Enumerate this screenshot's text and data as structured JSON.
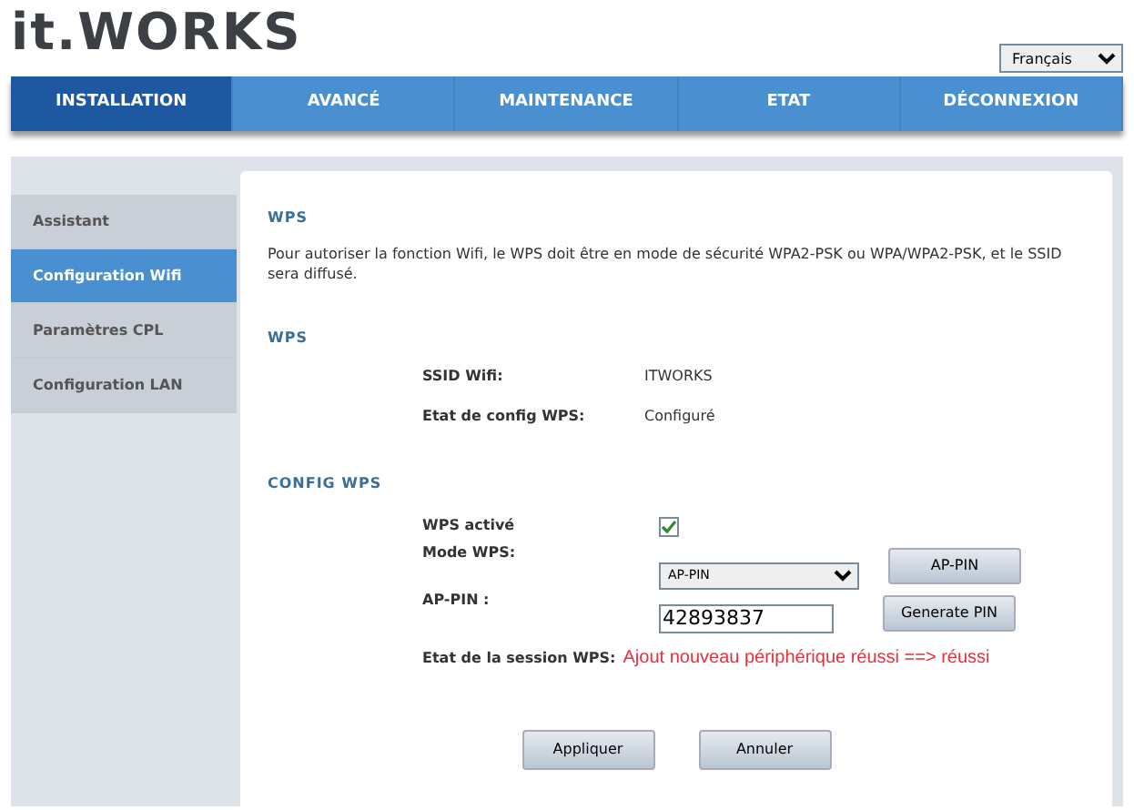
{
  "logo": "it.WORKS",
  "language": {
    "value": "Français"
  },
  "tabs": [
    {
      "label": "INSTALLATION",
      "selected": true
    },
    {
      "label": "AVANCÉ",
      "selected": false
    },
    {
      "label": "MAINTENANCE",
      "selected": false
    },
    {
      "label": "ETAT",
      "selected": false
    },
    {
      "label": "DÉCONNEXION",
      "selected": false
    }
  ],
  "sidebar": {
    "items": [
      {
        "label": "Assistant",
        "selected": false
      },
      {
        "label": "Configuration Wifi",
        "selected": true
      },
      {
        "label": "Paramètres CPL",
        "selected": false
      },
      {
        "label": "Configuration LAN",
        "selected": false
      }
    ]
  },
  "intro": {
    "heading": "WPS",
    "text": "Pour autoriser la fonction Wifi, le WPS doit être en mode de sécurité WPA2-PSK ou WPA/WPA2-PSK, et le SSID sera diffusé."
  },
  "wps": {
    "heading": "WPS",
    "rows": [
      {
        "label": "SSID Wifi:",
        "value": "ITWORKS"
      },
      {
        "label": "Etat de config WPS:",
        "value": "Configuré"
      }
    ]
  },
  "config": {
    "heading": "CONFIG WPS",
    "wps_enabled": {
      "label": "WPS activé",
      "checked": true
    },
    "mode": {
      "label": "Mode WPS:",
      "value": "AP-PIN",
      "button": "AP-PIN"
    },
    "ap_pin": {
      "label": "AP-PIN :",
      "value": "42893837",
      "button": "Generate PIN"
    },
    "session": {
      "label": "Etat de la session WPS:",
      "value": "Ajout nouveau périphérique réussi ==> réussi"
    }
  },
  "buttons": [
    "Appliquer",
    "Annuler"
  ]
}
